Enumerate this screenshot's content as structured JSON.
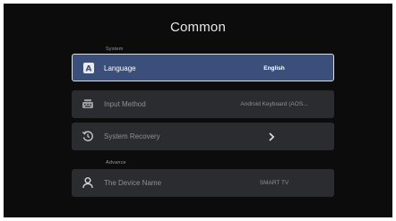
{
  "header": {
    "title": "Common"
  },
  "sections": {
    "system_label": "System",
    "advance_label": "Advance"
  },
  "rows": [
    {
      "label": "Language",
      "value": "English",
      "icon": "language-icon",
      "selected": true
    },
    {
      "label": "Input Method",
      "value": "Android Keyboard (AOS...",
      "icon": "keyboard-icon",
      "selected": false
    },
    {
      "label": "System Recovery",
      "value": "",
      "icon": "recovery-icon",
      "selected": false
    },
    {
      "label": "The Device Name",
      "value": "SMART TV",
      "icon": "person-icon",
      "selected": false
    }
  ],
  "colors": {
    "background": "#0c0c0d",
    "row": "#2b2c2f",
    "selected_row": "#3a4f7a",
    "selected_border": "#d8dde6"
  }
}
